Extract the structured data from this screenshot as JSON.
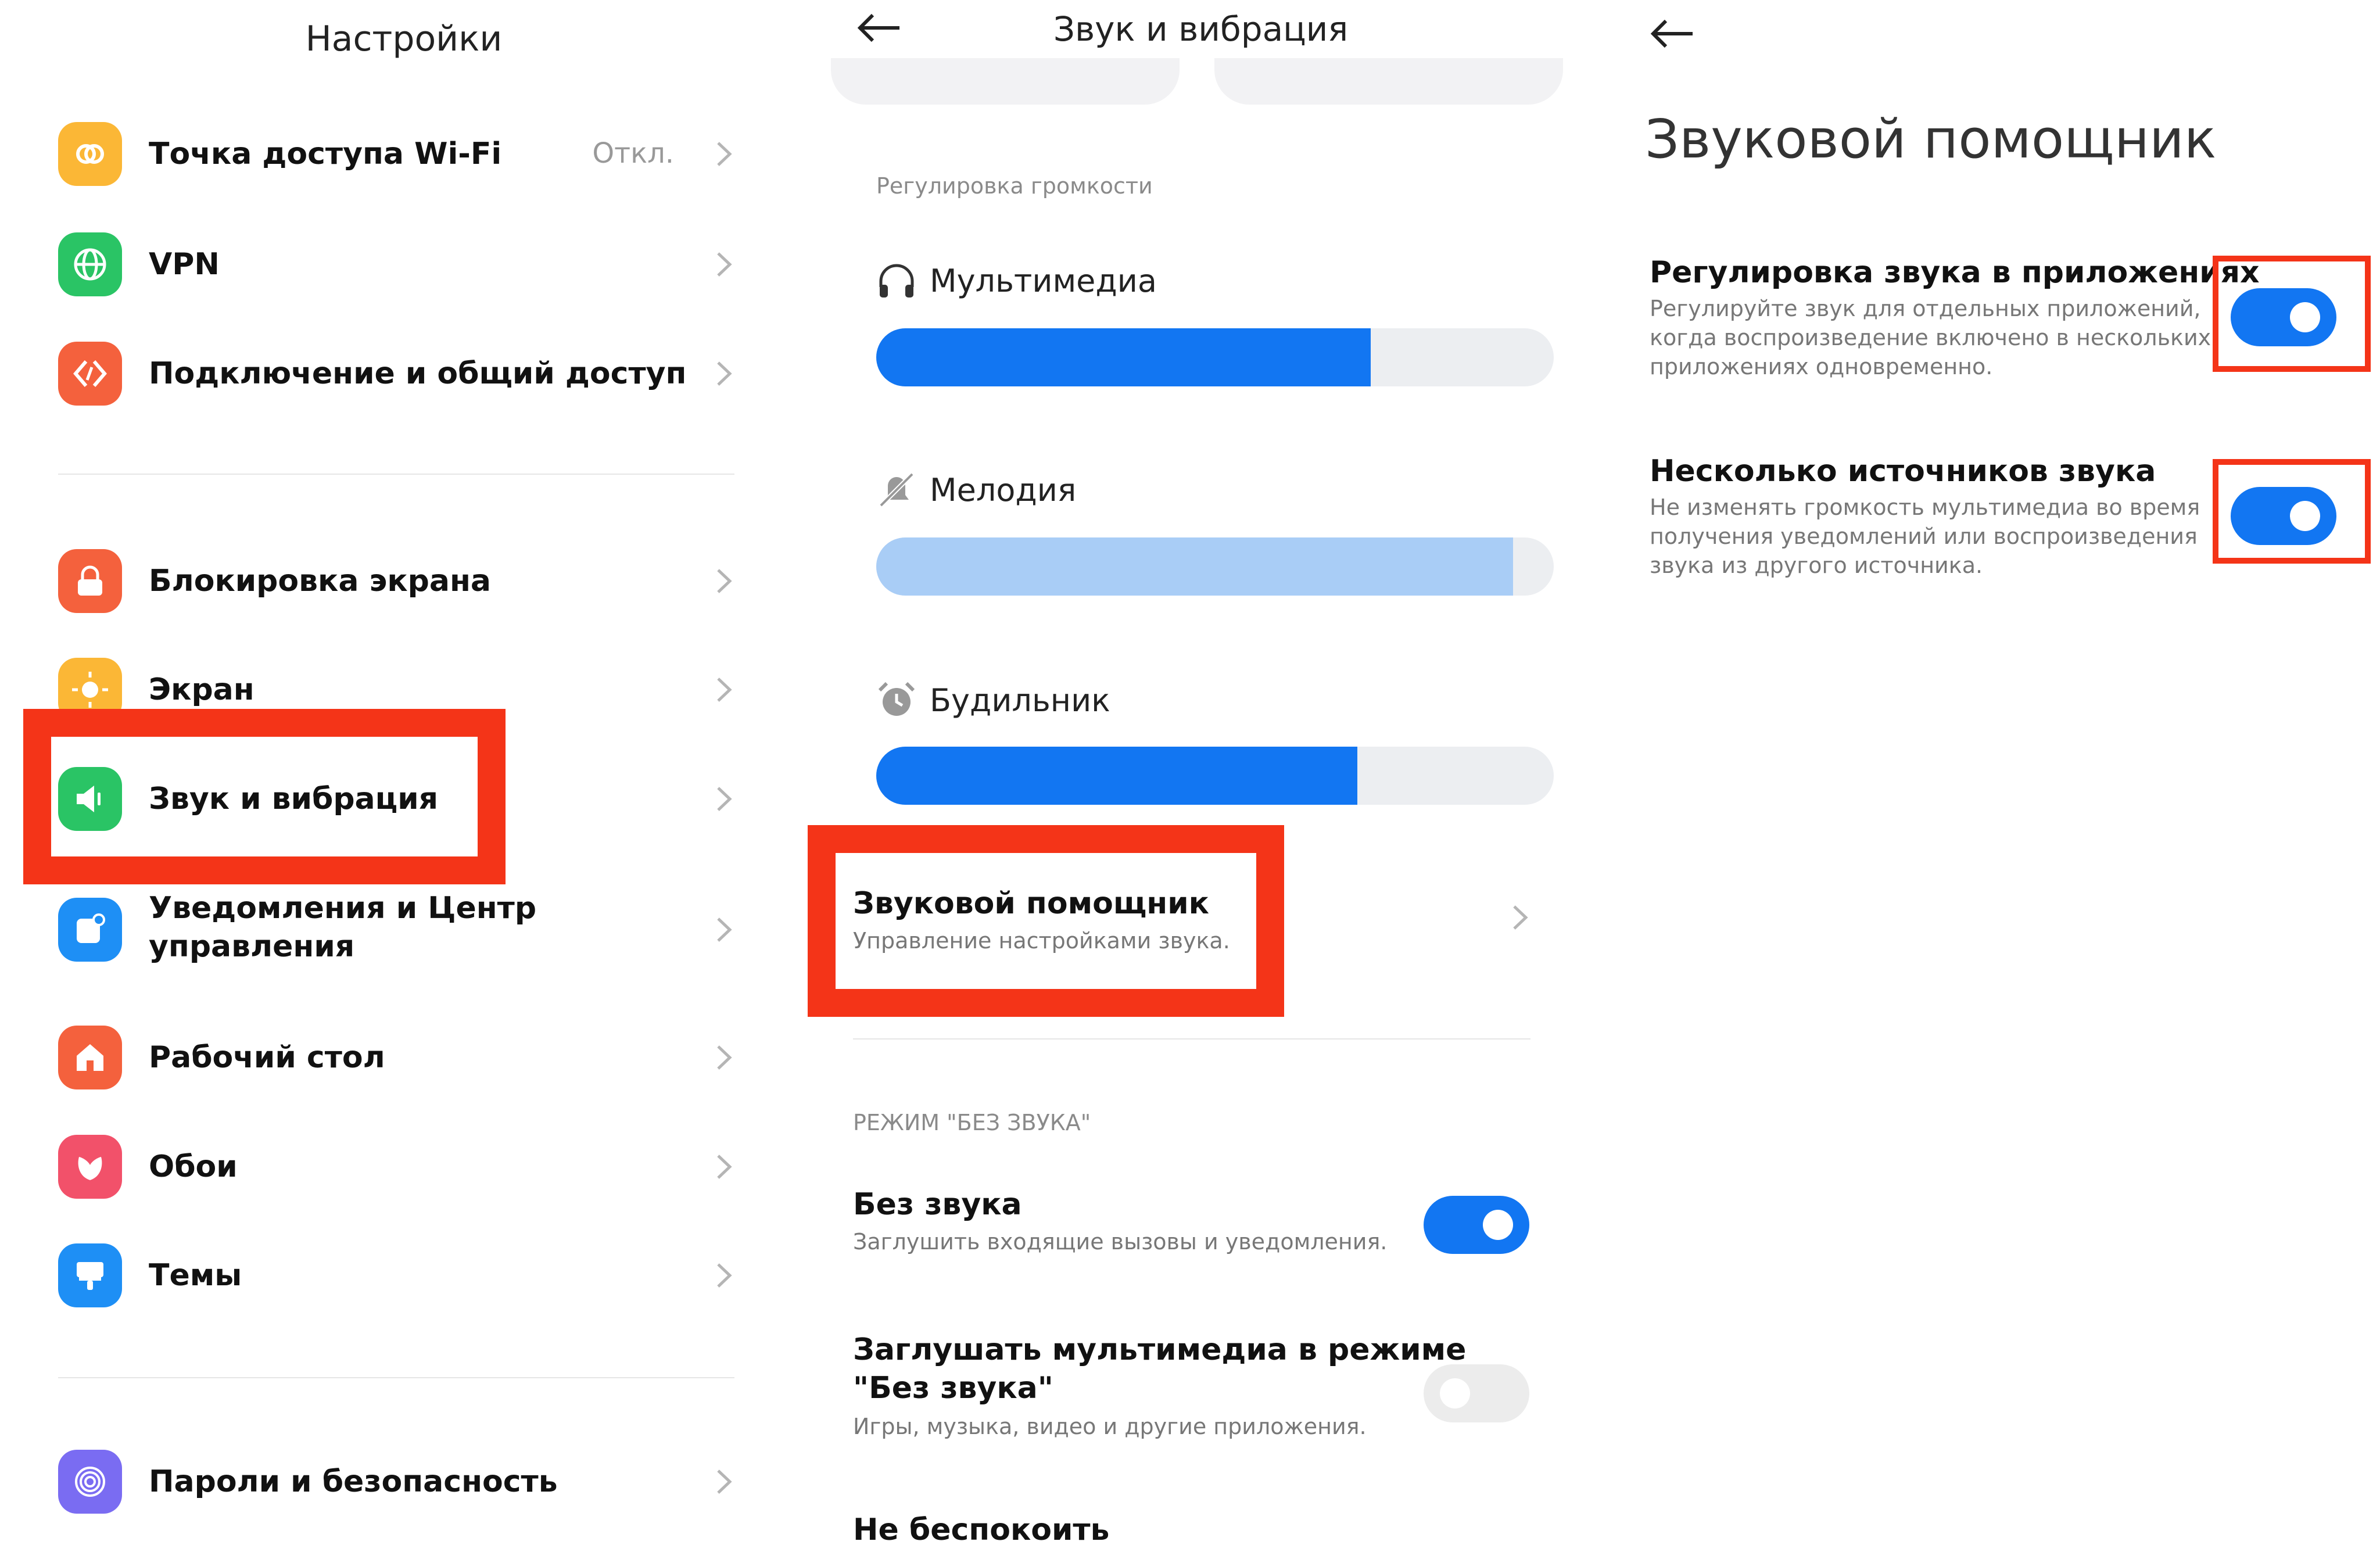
{
  "panel1": {
    "title": "Настройки",
    "items": [
      {
        "label": "Точка доступа Wi-Fi",
        "value": "Откл.",
        "icon": "hotspot-icon",
        "color": "#fbb736"
      },
      {
        "label": "VPN",
        "icon": "globe-icon",
        "color": "#2ac465"
      },
      {
        "label": "Подключение и общий доступ",
        "icon": "share-icon",
        "color": "#f4613d"
      },
      {
        "label": "Блокировка экрана",
        "icon": "lock-icon",
        "color": "#f4613d"
      },
      {
        "label": "Экран",
        "icon": "sun-icon",
        "color": "#fbb736"
      },
      {
        "label": "Звук и вибрация",
        "icon": "speaker-icon",
        "color": "#2ac465"
      },
      {
        "label_line1": "Уведомления и Центр",
        "label_line2": "управления",
        "icon": "notification-icon",
        "color": "#1e8ff5"
      },
      {
        "label": "Рабочий стол",
        "icon": "home-icon",
        "color": "#f4613d"
      },
      {
        "label": "Обои",
        "icon": "flower-icon",
        "color": "#f2516a"
      },
      {
        "label": "Темы",
        "icon": "brush-icon",
        "color": "#1e8ff5"
      },
      {
        "label": "Пароли и безопасность",
        "icon": "fingerprint-icon",
        "color": "#7a6cf2"
      }
    ]
  },
  "panel2": {
    "title": "Звук и вибрация",
    "volume_section": "Регулировка громкости",
    "volumes": [
      {
        "label": "Мультимедиа",
        "icon": "headphones-icon",
        "level": 0.73,
        "color": "#1276f2"
      },
      {
        "label": "Мелодия",
        "icon": "bell-off-icon",
        "level": 0.94,
        "color": "#a9cdf6"
      },
      {
        "label": "Будильник",
        "icon": "alarm-icon",
        "level": 0.71,
        "color": "#1276f2"
      }
    ],
    "assistant": {
      "title": "Звуковой помощник",
      "subtitle": "Управление настройками звука."
    },
    "silent_section": "РЕЖИМ \"БЕЗ ЗВУКА\"",
    "silent": {
      "title": "Без звука",
      "subtitle": "Заглушить входящие вызовы и уведомления.",
      "enabled": true
    },
    "mute_media": {
      "title_line1": "Заглушать мультимедиа в режиме",
      "title_line2": "\"Без звука\"",
      "subtitle": "Игры, музыка, видео и другие приложения.",
      "enabled": false
    },
    "dnd": {
      "title": "Не беспокоить"
    }
  },
  "panel3": {
    "title": "Звуковой помощник",
    "options": [
      {
        "title": "Регулировка звука в приложениях",
        "line1": "Регулируйте звук для отдельных приложений,",
        "line2": "когда воспроизведение включено в нескольких",
        "line3": "приложениях одновременно.",
        "enabled": true
      },
      {
        "title": "Несколько источников звука",
        "line1": "Не изменять громкость мультимедиа во время",
        "line2": "получения уведомлений или воспроизведения",
        "line3": "звука из другого источника.",
        "enabled": true
      }
    ]
  },
  "colors": {
    "accent": "#1276f2",
    "highlight": "#f43418"
  }
}
